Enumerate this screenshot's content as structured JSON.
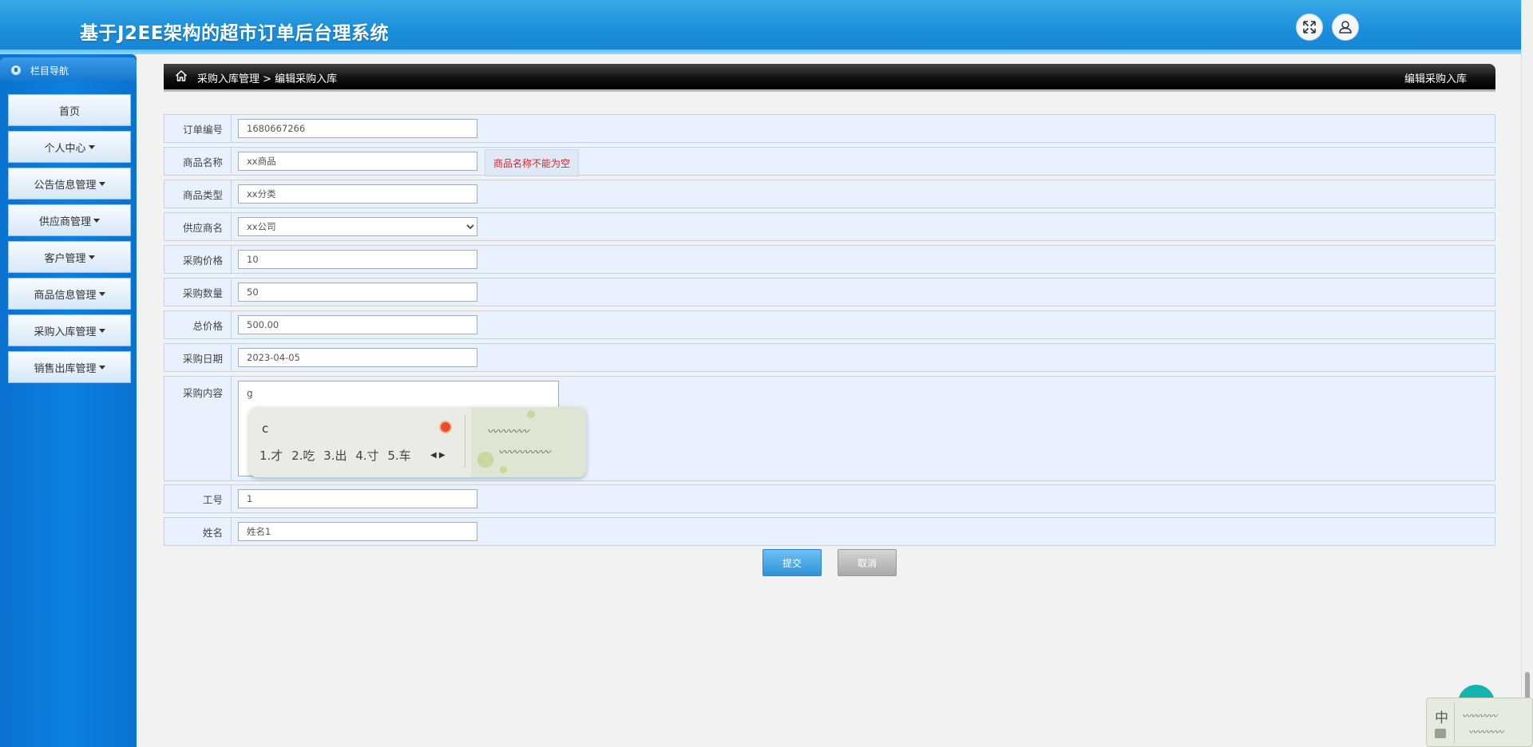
{
  "header": {
    "title": "基于J2EE架构的超市订单后台理系统"
  },
  "sidebar": {
    "title": "栏目导航",
    "items": [
      {
        "label": "首页"
      },
      {
        "label": "个人中心"
      },
      {
        "label": "公告信息管理"
      },
      {
        "label": "供应商管理"
      },
      {
        "label": "客户管理"
      },
      {
        "label": "商品信息管理"
      },
      {
        "label": "采购入库管理"
      },
      {
        "label": "销售出库管理"
      }
    ]
  },
  "breadcrumb": {
    "path": "采购入库管理 > 编辑采购入库",
    "page_title": "编辑采购入库"
  },
  "form": {
    "order_no": {
      "label": "订单编号",
      "value": "1680667266"
    },
    "product_name": {
      "label": "商品名称",
      "value": "xx商品",
      "error": "商品名称不能为空"
    },
    "product_type": {
      "label": "商品类型",
      "value": "xx分类"
    },
    "supplier": {
      "label": "供应商名",
      "selected": "xx公司"
    },
    "price": {
      "label": "采购价格",
      "value": "10"
    },
    "quantity": {
      "label": "采购数量",
      "value": "50"
    },
    "total": {
      "label": "总价格",
      "value": "500.00"
    },
    "date": {
      "label": "采购日期",
      "value": "2023-04-05"
    },
    "content": {
      "label": "采购内容",
      "value": "g"
    },
    "employee_no": {
      "label": "工号",
      "value": "1"
    },
    "name": {
      "label": "姓名",
      "value": "姓名1"
    }
  },
  "buttons": {
    "submit": "提交",
    "cancel": "取消"
  },
  "ime": {
    "composition": "c",
    "candidates": "1.才 2.吃 3.出 4.寸 5.车",
    "indicator": "中"
  }
}
